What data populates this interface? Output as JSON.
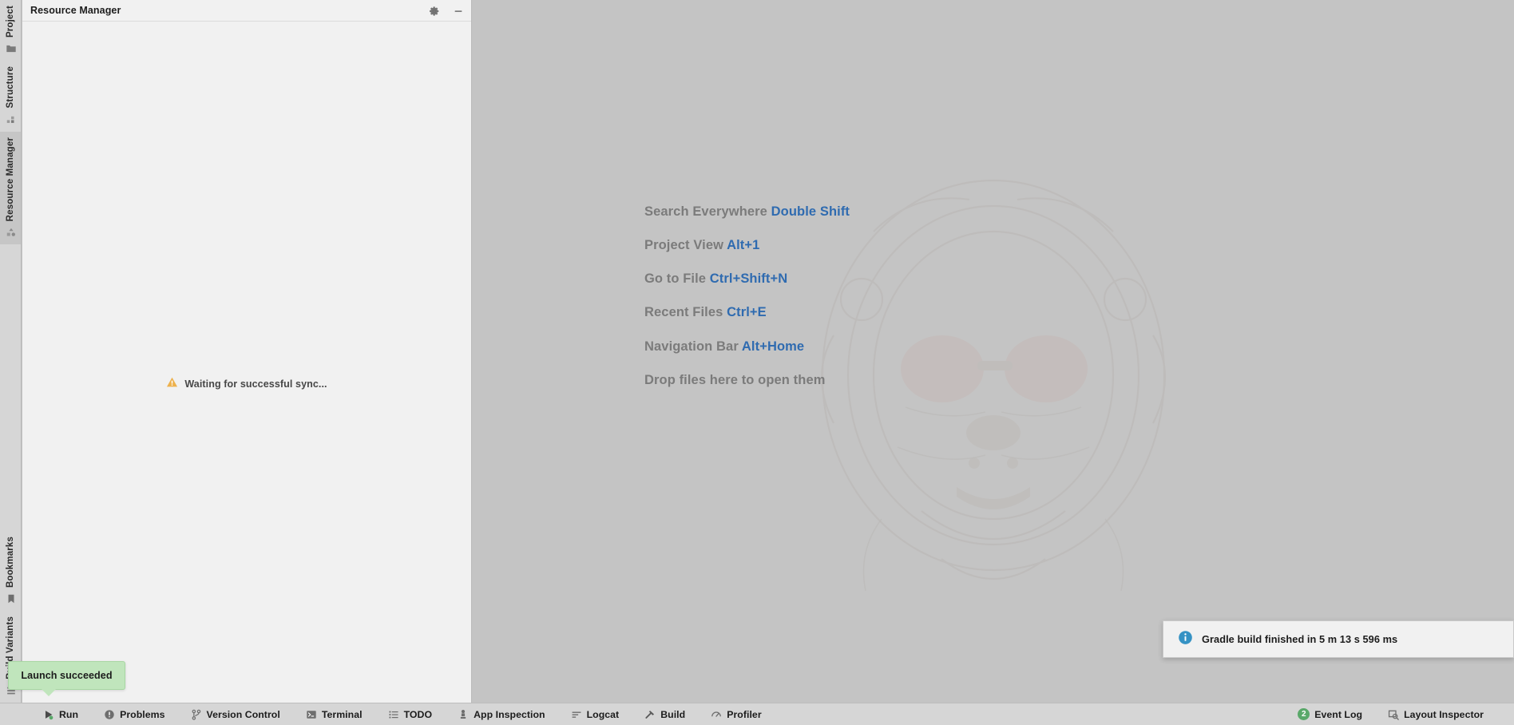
{
  "colors": {
    "accent_blue": "#2f6bb0",
    "editor_bg": "#c4c4c4",
    "panel_bg": "#f1f1f1",
    "stripe_bg": "#d6d6d6",
    "success_green": "#c0e5bc",
    "badge_green": "#59a869",
    "warning_amber": "#edb14c",
    "info_blue": "#3592c4"
  },
  "tool_stripe": {
    "top_items": [
      {
        "label": "Project",
        "icon": "folder-icon",
        "selected": false
      },
      {
        "label": "Structure",
        "icon": "structure-icon",
        "selected": false
      },
      {
        "label": "Resource Manager",
        "icon": "resource-manager-icon",
        "selected": true
      }
    ],
    "bottom_items": [
      {
        "label": "Bookmarks",
        "icon": "bookmark-icon",
        "selected": false
      },
      {
        "label": "Build Variants",
        "icon": "build-variants-icon",
        "selected": false
      }
    ]
  },
  "resource_manager": {
    "title": "Resource Manager",
    "settings_label": "Settings",
    "minimize_label": "Minimize",
    "empty_state": {
      "icon": "warning-triangle-icon",
      "message": "Waiting for successful sync..."
    }
  },
  "editor": {
    "tips": [
      {
        "label": "Search Everywhere",
        "shortcut": "Double Shift"
      },
      {
        "label": "Project View",
        "shortcut": "Alt+1"
      },
      {
        "label": "Go to File",
        "shortcut": "Ctrl+Shift+N"
      },
      {
        "label": "Recent Files",
        "shortcut": "Ctrl+E"
      },
      {
        "label": "Navigation Bar",
        "shortcut": "Alt+Home"
      },
      {
        "label": "Drop files here to open them",
        "shortcut": ""
      }
    ]
  },
  "notifications": {
    "gradle": {
      "icon": "info-circle-icon",
      "text": "Gradle build finished in 5 m 13 s 596 ms"
    },
    "launch": {
      "text": "Launch succeeded"
    }
  },
  "bottom_bar": {
    "left_items": [
      {
        "label": "Run",
        "icon": "run-icon"
      },
      {
        "label": "Problems",
        "icon": "problems-icon"
      },
      {
        "label": "Version Control",
        "icon": "version-control-icon"
      },
      {
        "label": "Terminal",
        "icon": "terminal-icon"
      },
      {
        "label": "TODO",
        "icon": "todo-icon"
      },
      {
        "label": "App Inspection",
        "icon": "app-inspection-icon"
      },
      {
        "label": "Logcat",
        "icon": "logcat-icon"
      },
      {
        "label": "Build",
        "icon": "build-icon"
      },
      {
        "label": "Profiler",
        "icon": "profiler-icon"
      }
    ],
    "right_items": [
      {
        "label": "Event Log",
        "icon": "event-log-icon",
        "badge": "2"
      },
      {
        "label": "Layout Inspector",
        "icon": "layout-inspector-icon",
        "badge": ""
      }
    ]
  }
}
